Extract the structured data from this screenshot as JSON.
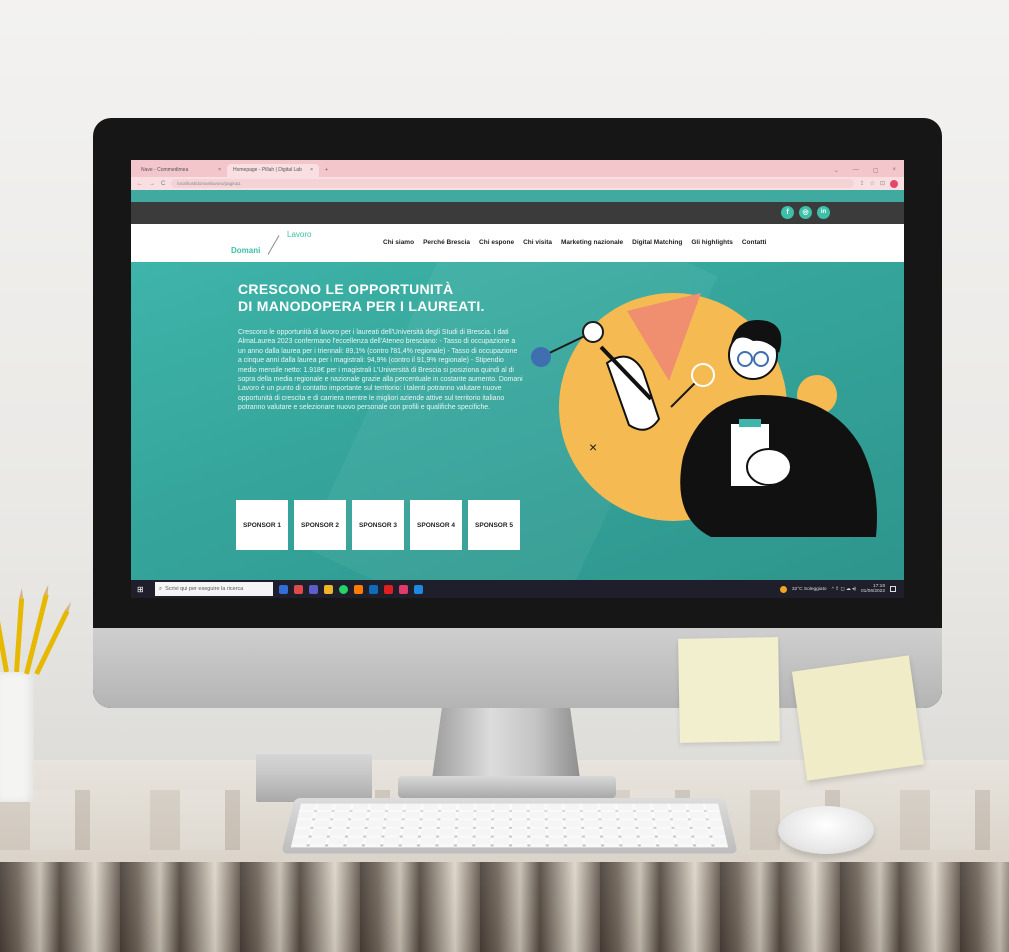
{
  "browser": {
    "tabs": [
      {
        "label": "Nave - Commedimea",
        "close": "×"
      },
      {
        "label": "Homepage - Pillah | Digital Lab",
        "close": "×"
      }
    ],
    "new_tab": "+",
    "window_controls": [
      "⌄",
      "—",
      "▢",
      "×"
    ],
    "nav_arrows": [
      "←",
      "→",
      "C"
    ],
    "url": "localhost/domanilavoro/pagina1",
    "url_icons": [
      "⇪",
      "☆",
      "⊡"
    ]
  },
  "social": [
    {
      "name": "facebook",
      "glyph": "f"
    },
    {
      "name": "instagram",
      "glyph": "◎"
    },
    {
      "name": "linkedin",
      "glyph": "in"
    }
  ],
  "logo": {
    "top": "Lavoro",
    "bottom": "Domani"
  },
  "menu": [
    "Chi siamo",
    "Perché Brescia",
    "Chi espone",
    "Chi visita",
    "Marketing nazionale",
    "Digital Matching",
    "Gli highlights",
    "Contatti"
  ],
  "hero": {
    "title_line1": "CRESCONO LE OPPORTUNITÀ",
    "title_line2": "DI MANODOPERA PER I LAUREATI.",
    "body": "Crescono le opportunità di lavoro per i laureati dell'Università degli Studi di Brescia. I dati AlmaLaurea 2023 confermano l'eccellenza dell'Ateneo bresciano: - Tasso di occupazione a un anno dalla laurea per i triennali: 89,1% (contro l'81,4% regionale) - Tasso di occupazione a cinque anni dalla laurea per i magistrali: 94,9% (contro il 91,9% regionale) - Stipendio medio mensile netto: 1.918€ per i magistrali   L'Università di Brescia si posiziona quindi al di sopra della media regionale e nazionale grazie alla percentuale in costante aumento. Domani Lavoro è un punto di contatto importante sul territorio: i talenti potranno valutare nuove opportunità di crescita e di carriera mentre le migliori aziende attive sul territorio italiano potranno valutare e selezionare nuovo personale con profili e qualifiche specifiche.",
    "sponsors": [
      "SPONSOR 1",
      "SPONSOR 2",
      "SPONSOR 3",
      "SPONSOR 4",
      "SPONSOR 5"
    ]
  },
  "taskbar": {
    "start": "⊞",
    "search_icon": "⌕",
    "search_placeholder": "Scrivi qui per eseguire la ricerca",
    "apps": [
      {
        "name": "explorer",
        "color": "#2f6fd6"
      },
      {
        "name": "chrome",
        "color": "#e04a4a"
      },
      {
        "name": "teams",
        "color": "#5b5fc7"
      },
      {
        "name": "files",
        "color": "#f0b429"
      },
      {
        "name": "whatsapp",
        "color": "#25d366"
      },
      {
        "name": "illustrator",
        "color": "#ff7c00"
      },
      {
        "name": "outlook",
        "color": "#0f6cbd"
      },
      {
        "name": "acrobat",
        "color": "#e02020"
      },
      {
        "name": "indesign",
        "color": "#e03b6b"
      },
      {
        "name": "photoshop",
        "color": "#1e88e5"
      }
    ],
    "weather": "32°C Soleggiato",
    "tray": "^ ⇧ ◻ ☁ ◂)",
    "time": "17:18",
    "date": "01/06/2022"
  }
}
